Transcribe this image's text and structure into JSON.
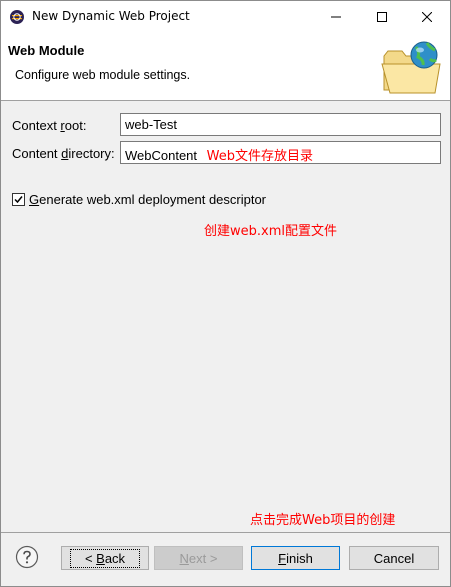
{
  "window": {
    "title": "New Dynamic Web Project"
  },
  "header": {
    "title": "Web Module",
    "description": "Configure web module settings."
  },
  "form": {
    "context_root": {
      "label_prefix": "Context ",
      "label_mnemonic": "r",
      "label_suffix": "oot:",
      "value": "web-Test"
    },
    "content_directory": {
      "label_prefix": "Content ",
      "label_mnemonic": "d",
      "label_suffix": "irectory:",
      "value": "WebContent",
      "annotation": "Web文件存放目录"
    },
    "generate_webxml": {
      "checked": true,
      "label_mnemonic": "G",
      "label_suffix": "enerate web.xml deployment descriptor",
      "annotation": "创建web.xml配置文件"
    }
  },
  "annotations": {
    "finish_note": "点击完成Web项目的创建"
  },
  "buttons": {
    "back_prefix": "< ",
    "back_mnemonic": "B",
    "back_suffix": "ack",
    "next_mnemonic": "N",
    "next_suffix": "ext >",
    "finish_mnemonic": "F",
    "finish_suffix": "inish",
    "cancel": "Cancel"
  },
  "colors": {
    "annotation": "#ff0000",
    "focus_border": "#0078d7"
  }
}
